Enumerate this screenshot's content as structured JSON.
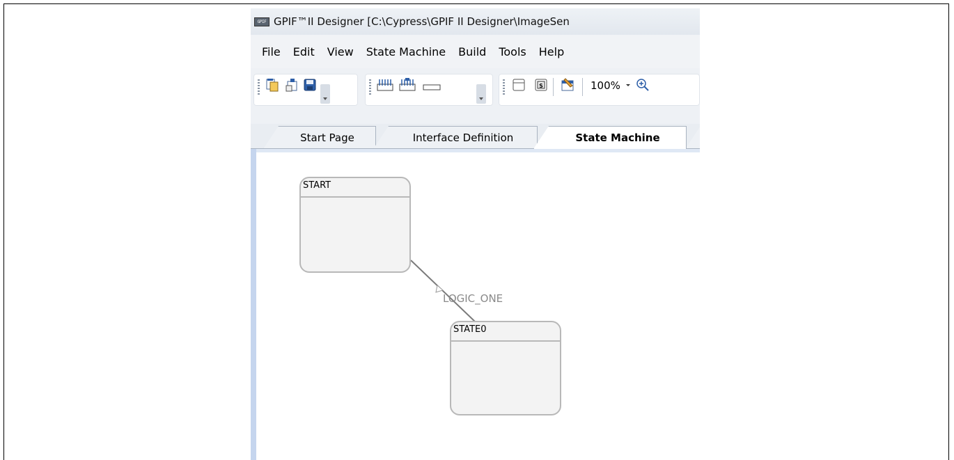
{
  "window": {
    "title": "GPIF™II Designer [C:\\Cypress\\GPIF II Designer\\ImageSen",
    "icon": "gpif-app-icon",
    "icon_text": "GPIF"
  },
  "menu": {
    "items": [
      "File",
      "Edit",
      "View",
      "State Machine",
      "Build",
      "Tools",
      "Help"
    ]
  },
  "toolbar": {
    "zoom_value": "100%",
    "icons": [
      "new-project-icon",
      "open-project-icon",
      "save-icon",
      "input-pins-icon",
      "output-pins-icon",
      "flag-icon",
      "state-icon",
      "start-state-icon",
      "properties-icon",
      "zoom-in-icon"
    ]
  },
  "tabs": [
    {
      "label": "Start Page",
      "active": false
    },
    {
      "label": "Interface Definition",
      "active": false
    },
    {
      "label": "State Machine",
      "active": true
    }
  ],
  "canvas": {
    "states": [
      {
        "name": "START"
      },
      {
        "name": "STATE0"
      }
    ],
    "transitions": [
      {
        "from": "START",
        "to": "STATE0",
        "condition": "LOGIC_ONE"
      }
    ]
  },
  "colors": {
    "state_border": "#b8b8b8",
    "state_fill": "#f3f3f3",
    "canvas_border": "#c5d5ee"
  }
}
